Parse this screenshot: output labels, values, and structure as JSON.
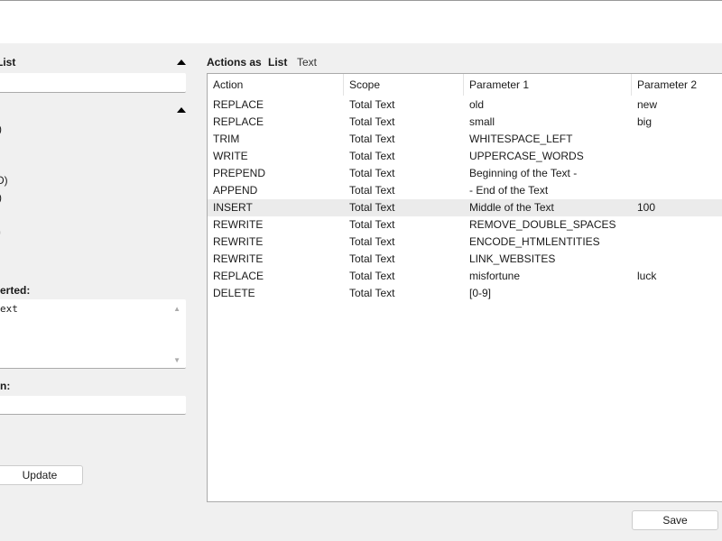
{
  "left": {
    "list_heading": "List",
    "fragments": [
      ")",
      "D)",
      ")",
      ")"
    ],
    "textarea_label": "erted:",
    "textarea_value": "ext",
    "field_label": "n:",
    "update_label": "Update"
  },
  "actions_header": {
    "label": "Actions as",
    "tab_list": "List",
    "tab_text": "Text"
  },
  "columns": [
    "Action",
    "Scope",
    "Parameter 1",
    "Parameter 2"
  ],
  "rows": [
    [
      "REPLACE",
      "Total Text",
      "old",
      "new"
    ],
    [
      "REPLACE",
      "Total Text",
      "small",
      "big"
    ],
    [
      "TRIM",
      "Total Text",
      "WHITESPACE_LEFT",
      ""
    ],
    [
      "WRITE",
      "Total Text",
      "UPPERCASE_WORDS",
      ""
    ],
    [
      "PREPEND",
      "Total Text",
      "Beginning of the Text -",
      ""
    ],
    [
      "APPEND",
      "Total Text",
      "- End of the Text",
      ""
    ],
    [
      "INSERT",
      "Total Text",
      "Middle of the Text",
      "100"
    ],
    [
      "REWRITE",
      "Total Text",
      "REMOVE_DOUBLE_SPACES",
      ""
    ],
    [
      "REWRITE",
      "Total Text",
      "ENCODE_HTMLENTITIES",
      ""
    ],
    [
      "REWRITE",
      "Total Text",
      "LINK_WEBSITES",
      ""
    ],
    [
      "REPLACE",
      "Total Text",
      "misfortune",
      "luck"
    ],
    [
      "DELETE",
      "Total Text",
      "[0-9]",
      ""
    ]
  ],
  "selected_row": 6,
  "save_label": "Save"
}
